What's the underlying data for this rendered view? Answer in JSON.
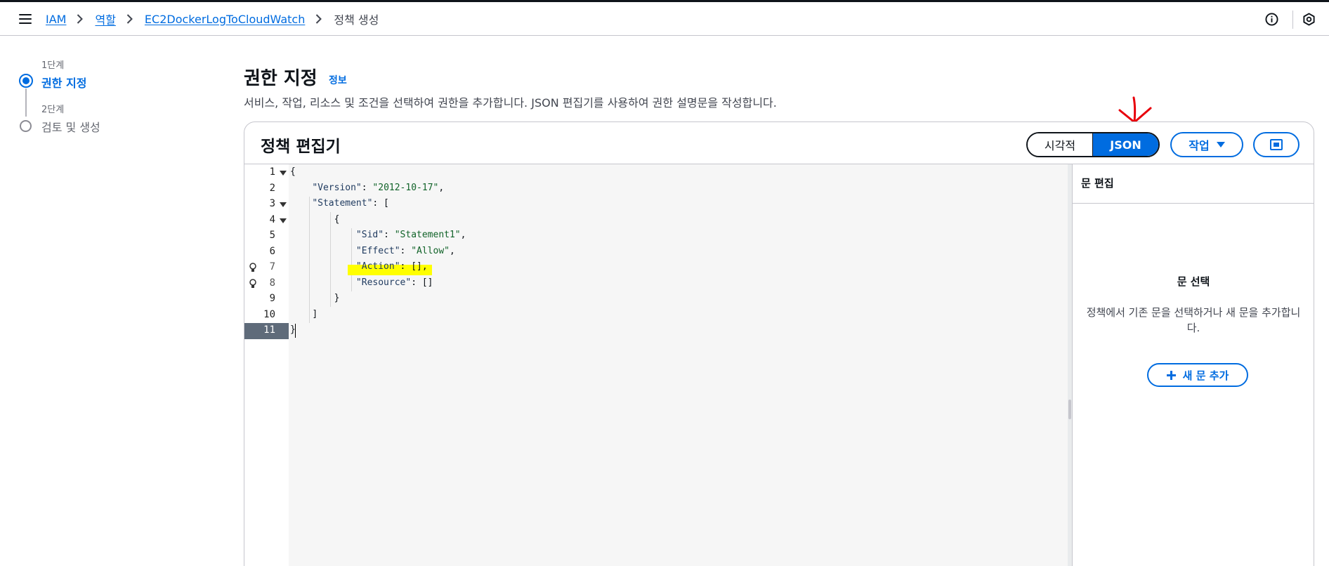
{
  "breadcrumb": {
    "items": [
      "IAM",
      "역할",
      "EC2DockerLogToCloudWatch"
    ],
    "current": "정책 생성"
  },
  "steps": [
    {
      "sub": "1단계",
      "label": "권한 지정",
      "state": "active"
    },
    {
      "sub": "2단계",
      "label": "검토 및 생성",
      "state": "inactive"
    }
  ],
  "main": {
    "title": "권한 지정",
    "info_link": "정보",
    "description": "서비스, 작업, 리소스 및 조건을 선택하여 권한을 추가합니다. JSON 편집기를 사용하여 권한 설명문을 작성합니다."
  },
  "editor": {
    "title": "정책 편집기",
    "mode_visual": "시각적",
    "mode_json": "JSON",
    "selected_mode": "JSON",
    "actions_label": "작업",
    "line_numbers": [
      "1",
      "2",
      "3",
      "4",
      "5",
      "6",
      "7",
      "8",
      "9",
      "10",
      "11"
    ],
    "active_line": "11",
    "code": {
      "l1": "{",
      "l2_key": "\"Version\"",
      "l2_val": "\"2012-10-17\"",
      "l3_key": "\"Statement\"",
      "l3_rest": ": [",
      "l4": "{",
      "l5_key": "\"Sid\"",
      "l5_val": "\"Statement1\"",
      "l6_key": "\"Effect\"",
      "l6_val": "\"Allow\"",
      "l7_key": "\"Action\"",
      "l7_rest": ": [],",
      "l8_key": "\"Resource\"",
      "l8_rest": ": []",
      "l9": "}",
      "l10": "]",
      "l11": "}"
    }
  },
  "panel": {
    "title": "문 편집",
    "empty_title": "문 선택",
    "empty_desc": "정책에서 기존 문을 선택하거나 새 문을 추가합니다.",
    "add_button": "새 문 추가"
  },
  "colors": {
    "accent": "#006ce0",
    "highlight": "#ffff00",
    "annotation_arrow": "#e8000b"
  }
}
